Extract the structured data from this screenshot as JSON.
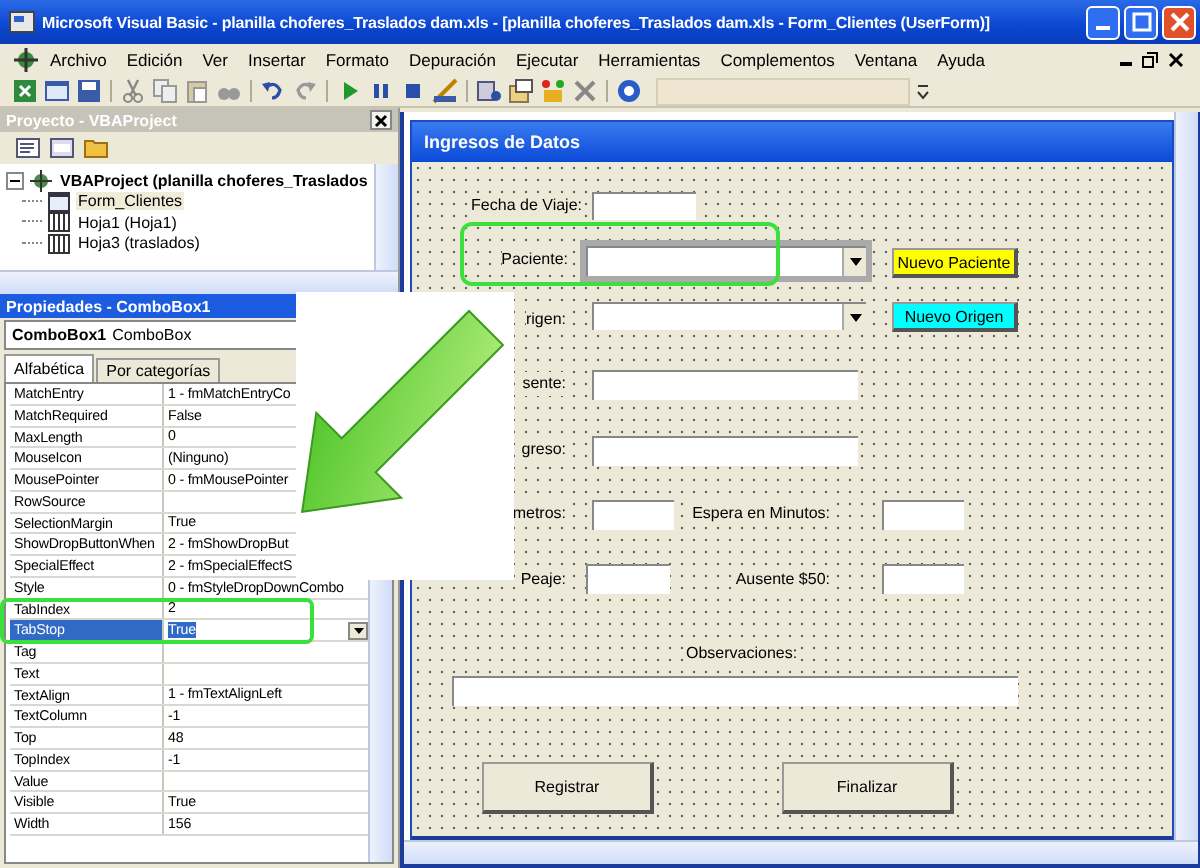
{
  "window": {
    "title": "Microsoft Visual Basic - planilla choferes_Traslados dam.xls - [planilla choferes_Traslados dam.xls - Form_Clientes (UserForm)]"
  },
  "menu": [
    "Archivo",
    "Edición",
    "Ver",
    "Insertar",
    "Formato",
    "Depuración",
    "Ejecutar",
    "Herramientas",
    "Complementos",
    "Ventana",
    "Ayuda"
  ],
  "project_panel": {
    "title": "Proyecto - VBAProject",
    "tree": [
      {
        "label": "VBAProject (planilla choferes_Traslados",
        "expanded": true,
        "selected": false,
        "children": [
          {
            "label": "Form_Clientes",
            "kind": "form",
            "selected": true
          },
          {
            "label": "Hoja1 (Hoja1)",
            "kind": "sheet",
            "selected": false
          },
          {
            "label": "Hoja3 (traslados)",
            "kind": "sheet",
            "selected": false
          }
        ]
      }
    ]
  },
  "properties_panel": {
    "title": "Propiedades - ComboBox1",
    "object": "**ComboBox1** ComboBox",
    "tabs": [
      {
        "label": "Alfabética",
        "selected": true
      },
      {
        "label": "Por categorías",
        "selected": false
      }
    ],
    "rows": [
      {
        "name": "MatchEntry",
        "value": "1 - fmMatchEntryCo",
        "selected": false
      },
      {
        "name": "MatchRequired",
        "value": "False",
        "selected": false
      },
      {
        "name": "MaxLength",
        "value": "0",
        "selected": false
      },
      {
        "name": "MouseIcon",
        "value": "(Ninguno)",
        "selected": false
      },
      {
        "name": "MousePointer",
        "value": "0 - fmMousePointer",
        "selected": false
      },
      {
        "name": "RowSource",
        "selected": false
      },
      {
        "name": "SelectionMargin",
        "value": "True",
        "selected": false
      },
      {
        "name": "ShowDropButtonWhen",
        "value": "2 - fmShowDropBut",
        "selected": false
      },
      {
        "name": "SpecialEffect",
        "value": "2 - fmSpecialEffectS",
        "selected": false
      },
      {
        "name": "Style",
        "value": "0 - fmStyleDropDownCombo",
        "selected": false
      },
      {
        "name": "TabIndex",
        "value": "2",
        "selected": false
      },
      {
        "name": "TabStop",
        "value": "True",
        "selected": true
      },
      {
        "name": "Tag",
        "selected": false
      },
      {
        "name": "Text",
        "selected": false
      },
      {
        "name": "TextAlign",
        "value": "1 - fmTextAlignLeft",
        "selected": false
      },
      {
        "name": "TextColumn",
        "value": "-1",
        "selected": false
      },
      {
        "name": "Top",
        "value": "48",
        "selected": false
      },
      {
        "name": "TopIndex",
        "value": "-1",
        "selected": false
      },
      {
        "name": "Value",
        "selected": false
      },
      {
        "name": "Visible",
        "value": "True",
        "selected": false
      },
      {
        "name": "Width",
        "value": "156",
        "selected": false
      }
    ]
  },
  "form": {
    "title": "Ingresos de Datos",
    "controls": [
      {
        "kind": "label",
        "text": "Fecha de Viaje:"
      },
      {
        "kind": "textbox",
        "selected": false
      },
      {
        "kind": "label",
        "text": "Paciente:"
      },
      {
        "kind": "combobox",
        "selected": true
      },
      {
        "kind": "button",
        "text": "Nuevo Paciente",
        "color": "#ffff00"
      },
      {
        "kind": "label",
        "text": "rigen:"
      },
      {
        "kind": "combobox",
        "selected": false
      },
      {
        "kind": "button",
        "text": "Nuevo Origen",
        "color": "#00ffff"
      },
      {
        "kind": "label",
        "text": "sente:"
      },
      {
        "kind": "textbox",
        "selected": false
      },
      {
        "kind": "label",
        "text": "greso:"
      },
      {
        "kind": "textbox",
        "selected": false
      },
      {
        "kind": "label",
        "text": "metros:"
      },
      {
        "kind": "textbox",
        "selected": false
      },
      {
        "kind": "label",
        "text": "Espera en Minutos:"
      },
      {
        "kind": "textbox",
        "selected": false
      },
      {
        "kind": "label",
        "text": "Peaje:"
      },
      {
        "kind": "textbox",
        "selected": false
      },
      {
        "kind": "label",
        "text": "Ausente $50:"
      },
      {
        "kind": "textbox",
        "selected": false
      },
      {
        "kind": "label",
        "text": "Observaciones:"
      },
      {
        "kind": "textbox",
        "selected": false
      },
      {
        "kind": "button",
        "text": "Registrar",
        "color": "#ece9d8"
      },
      {
        "kind": "button",
        "text": "Finalizar",
        "color": "#ece9d8"
      }
    ]
  }
}
